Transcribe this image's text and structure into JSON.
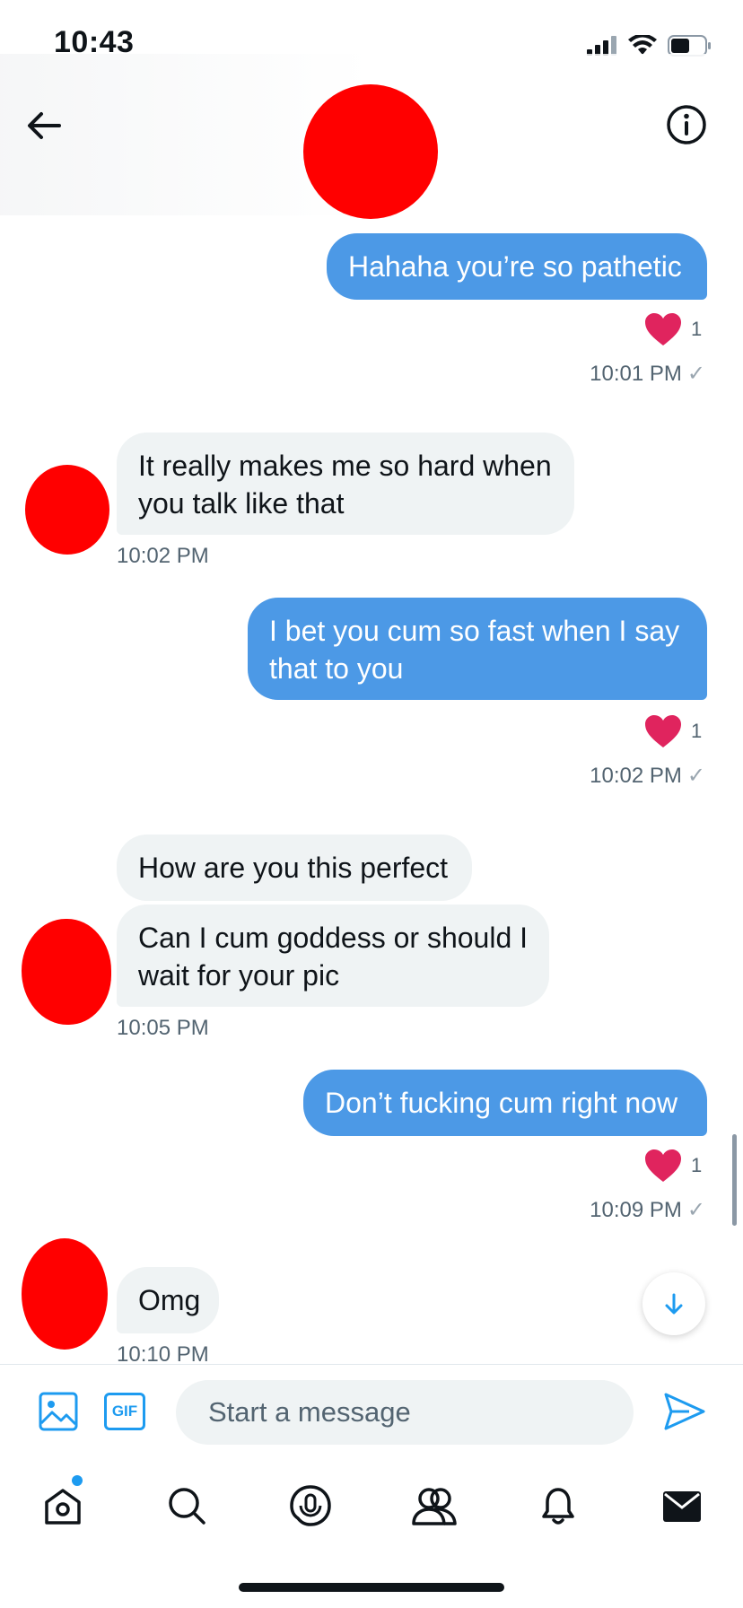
{
  "status_bar": {
    "time": "10:43",
    "icons": [
      "cellular-signal-icon",
      "wifi-icon",
      "battery-icon"
    ]
  },
  "header": {
    "back_icon": "arrow-left-icon",
    "info_icon": "info-icon"
  },
  "messages": [
    {
      "direction": "outgoing",
      "text": "Hahaha you’re so pathetic",
      "reaction": {
        "icon": "heart-icon",
        "count": "1"
      },
      "time": "10:01 PM"
    },
    {
      "direction": "incoming",
      "text": "It really makes me so hard when you talk like that",
      "time": "10:02 PM"
    },
    {
      "direction": "outgoing",
      "text": "I bet you cum so fast when I say that to you",
      "reaction": {
        "icon": "heart-icon",
        "count": "1"
      },
      "time": "10:02 PM"
    },
    {
      "direction": "incoming",
      "text": "How are you this perfect"
    },
    {
      "direction": "incoming",
      "text": "Can I cum goddess or should I wait for your pic",
      "time": "10:05 PM"
    },
    {
      "direction": "outgoing",
      "text": "Don’t fucking cum right now",
      "reaction": {
        "icon": "heart-icon",
        "count": "1"
      },
      "time": "10:09 PM"
    },
    {
      "direction": "incoming",
      "text": "Omg",
      "time": "10:10 PM"
    }
  ],
  "read_receipt": "✓",
  "compose": {
    "image_icon": "image-icon",
    "gif_label": "GIF",
    "placeholder": "Start a message",
    "value": "",
    "send_icon": "send-icon"
  },
  "scroll_down_icon": "arrow-down-icon",
  "bottom_nav": [
    {
      "name": "home",
      "icon": "home-icon",
      "has_notification_dot": true
    },
    {
      "name": "search",
      "icon": "search-icon"
    },
    {
      "name": "spaces",
      "icon": "spaces-microphone-icon"
    },
    {
      "name": "communities",
      "icon": "communities-icon"
    },
    {
      "name": "notifications",
      "icon": "bell-icon"
    },
    {
      "name": "messages",
      "icon": "envelope-icon",
      "active": true
    }
  ],
  "colors": {
    "outgoing_bubble": "#4c99e6",
    "incoming_bubble": "#eff3f4",
    "accent": "#1d9bf0",
    "heart": "#e0245e",
    "avatar_redaction": "#ff0000"
  }
}
